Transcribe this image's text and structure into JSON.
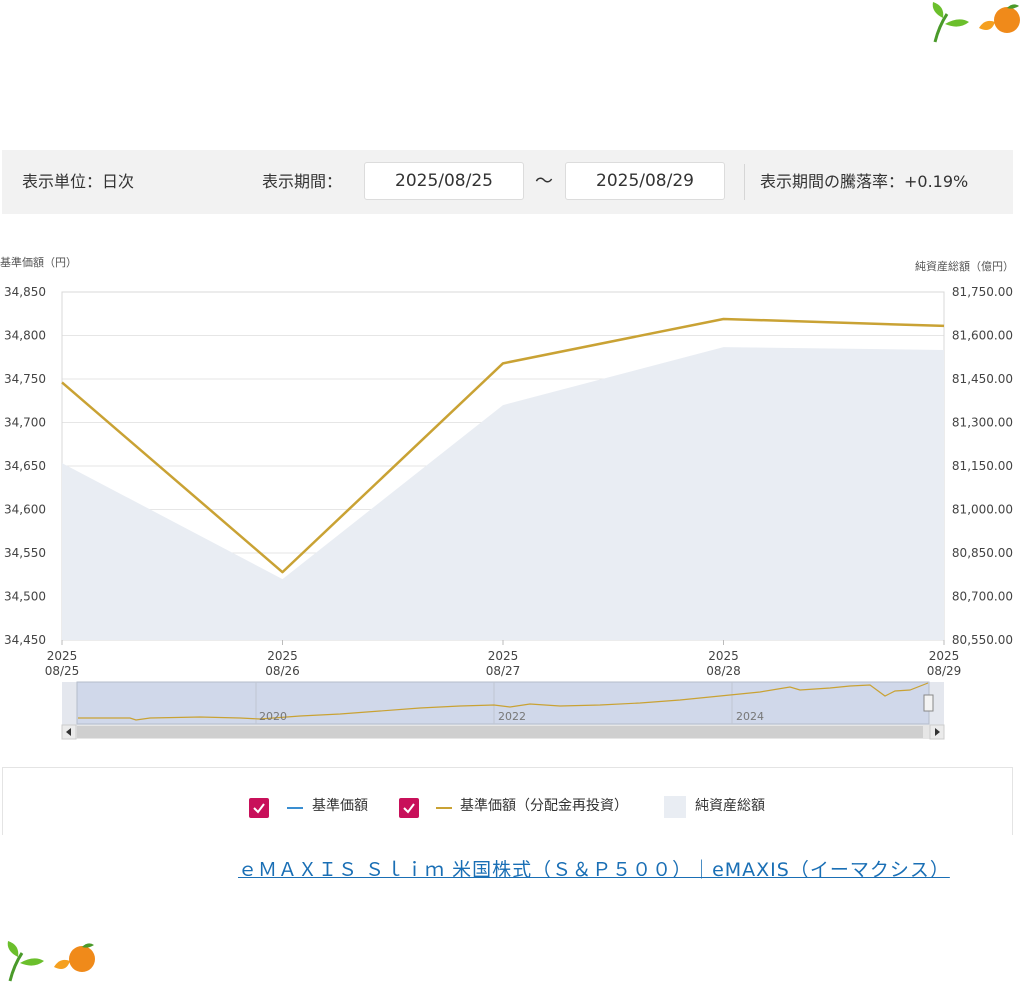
{
  "toolbar": {
    "unit_label": "表示単位：日次",
    "period_label": "表示期間：",
    "start_date": "2025/08/25",
    "tilde": "～",
    "end_date": "2025/08/29",
    "change_label": "表示期間の騰落率：+0.19%"
  },
  "chart_data": {
    "type": "line",
    "x_labels": [
      [
        "2025",
        "08/25"
      ],
      [
        "2025",
        "08/26"
      ],
      [
        "2025",
        "08/27"
      ],
      [
        "2025",
        "08/28"
      ],
      [
        "2025",
        "08/29"
      ]
    ],
    "left_axis": {
      "label": "基準価額（円）",
      "ylim": [
        34450,
        34850
      ],
      "ticks": [
        "34,850",
        "34,800",
        "34,750",
        "34,700",
        "34,650",
        "34,600",
        "34,550",
        "34,500",
        "34,450"
      ]
    },
    "right_axis": {
      "label": "純資産総額（億円）",
      "ylim": [
        80550,
        81750
      ],
      "ticks": [
        "81,750.00",
        "81,600.00",
        "81,450.00",
        "81,300.00",
        "81,150.00",
        "81,000.00",
        "80,850.00",
        "80,700.00",
        "80,550.00"
      ]
    },
    "series": [
      {
        "name": "基準価額（分配金再投資）",
        "type": "line",
        "axis": "left",
        "color": "#c9a234",
        "values": [
          34746,
          34528,
          34768,
          34819,
          34811
        ]
      },
      {
        "name": "純資産総額",
        "type": "area",
        "axis": "right",
        "color": "#e9edf3",
        "values": [
          81160,
          80760,
          81360,
          81560,
          81550
        ]
      }
    ],
    "grid": true,
    "navigator": {
      "year_labels": [
        "2020",
        "2022",
        "2024"
      ]
    }
  },
  "legend": {
    "item1": "基準価額",
    "item2": "基準価額（分配金再投資）",
    "item3": "純資産総額",
    "blue": "#3a8ed1",
    "gold": "#c9a234",
    "check": "#c8105a"
  },
  "link_text": "ｅＭＡＸＩＳ Ｓｌｉｍ 米国株式（Ｓ＆Ｐ５００）｜eMAXIS（イーマクシス）",
  "icons": [
    "leaf-icon",
    "orange-icon"
  ]
}
